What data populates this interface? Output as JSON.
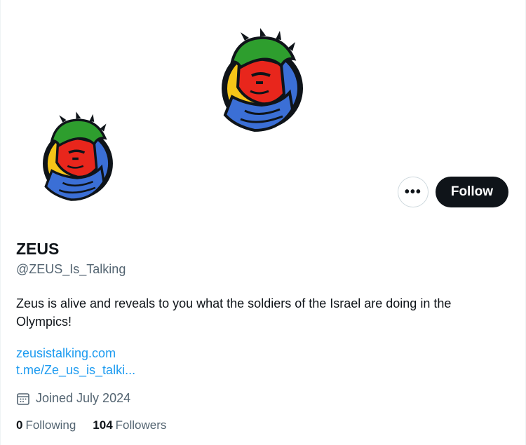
{
  "profile": {
    "display_name": "ZEUS",
    "handle": "@ZEUS_Is_Talking",
    "bio": "Zeus is alive and reveals to you what the soldiers of the Israel are doing in the Olympics!",
    "links": [
      "zeusistalking.com",
      "t.me/Ze_us_is_talki..."
    ],
    "joined": "Joined July 2024",
    "following_count": "0",
    "following_label": "Following",
    "followers_count": "104",
    "followers_label": "Followers"
  },
  "actions": {
    "more_label": "•••",
    "follow_label": "Follow"
  },
  "icons": {
    "banner": "zeus-logo-icon",
    "avatar": "zeus-logo-icon",
    "more": "more-dots-icon",
    "joined": "calendar-icon"
  },
  "colors": {
    "text_primary": "#0f1419",
    "text_secondary": "#536471",
    "link": "#1d9bf0",
    "follow_bg": "#0f1419",
    "logo_green": "#2e9e2e",
    "logo_red": "#e8261c",
    "logo_blue": "#3b6fd6",
    "logo_yellow": "#f5c518"
  }
}
